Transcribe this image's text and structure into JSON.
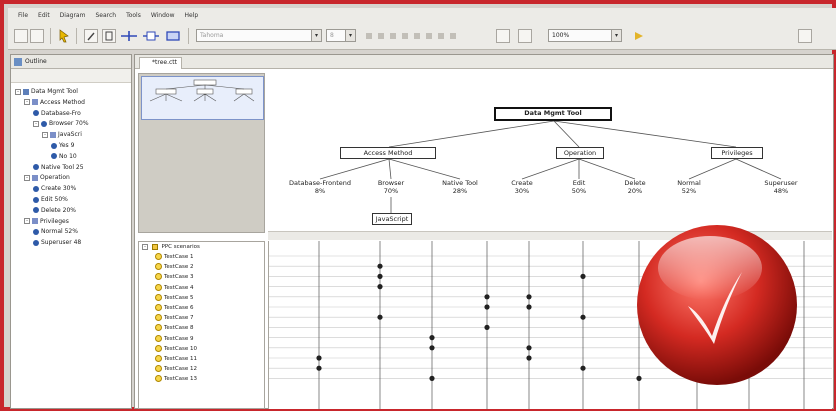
{
  "menu": [
    "File",
    "Edit",
    "Diagram",
    "Search",
    "Tools",
    "Window",
    "Help"
  ],
  "toolbar": {
    "font_combo": "Tahoma",
    "size_combo": "8",
    "zoom_combo": "100%"
  },
  "outline": {
    "tab_label": "Outline",
    "items": [
      {
        "label": "Data Mgmt Tool",
        "level": 0,
        "kind": "root",
        "twisty": "-"
      },
      {
        "label": "Access Method",
        "level": 1,
        "kind": "cat",
        "twisty": "-"
      },
      {
        "label": "Database-Fro",
        "level": 2,
        "kind": "leaf",
        "twisty": ""
      },
      {
        "label": "Browser 70%",
        "level": 2,
        "kind": "leaf",
        "twisty": "-"
      },
      {
        "label": "JavaScri",
        "level": 3,
        "kind": "cat",
        "twisty": "-"
      },
      {
        "label": "Yes 9",
        "level": 4,
        "kind": "leaf",
        "twisty": ""
      },
      {
        "label": "No 10",
        "level": 4,
        "kind": "leaf",
        "twisty": ""
      },
      {
        "label": "Native Tool 25",
        "level": 2,
        "kind": "leaf",
        "twisty": ""
      },
      {
        "label": "Operation",
        "level": 1,
        "kind": "cat",
        "twisty": "-"
      },
      {
        "label": "Create 30%",
        "level": 2,
        "kind": "leaf",
        "twisty": ""
      },
      {
        "label": "Edit 50%",
        "level": 2,
        "kind": "leaf",
        "twisty": ""
      },
      {
        "label": "Delete 20%",
        "level": 2,
        "kind": "leaf",
        "twisty": ""
      },
      {
        "label": "Privileges",
        "level": 1,
        "kind": "cat",
        "twisty": "-"
      },
      {
        "label": "Normal 52%",
        "level": 2,
        "kind": "leaf",
        "twisty": ""
      },
      {
        "label": "Superuser 48",
        "level": 2,
        "kind": "leaf",
        "twisty": ""
      }
    ]
  },
  "editor": {
    "tab_label": "*tree.ctt",
    "root_label": "Data Mgmt Tool",
    "categories": [
      "Access Method",
      "Operation",
      "Privileges"
    ],
    "leaves": [
      {
        "name": "Database-Frontend",
        "pct": "8%"
      },
      {
        "name": "Browser",
        "pct": "70%"
      },
      {
        "name": "Native Tool",
        "pct": "28%",
        "inline": true
      },
      {
        "name": "Create",
        "pct": "30%"
      },
      {
        "name": "Edit",
        "pct": "50%"
      },
      {
        "name": "Delete",
        "pct": "20%"
      },
      {
        "name": "Normal",
        "pct": "52%"
      },
      {
        "name": "Superuser",
        "pct": "48%"
      }
    ],
    "subnode": "JavaScript"
  },
  "testcases": {
    "group_label": "PPC scenarios",
    "items": [
      "TestCase 1",
      "TestCase 2",
      "TestCase 3",
      "TestCase 4",
      "TestCase 5",
      "TestCase 6",
      "TestCase 7",
      "TestCase 8",
      "TestCase 9",
      "TestCase 10",
      "TestCase 11",
      "TestCase 12",
      "TestCase 13"
    ]
  },
  "colors": {
    "frame": "#c8262c",
    "badge": "#d42a22"
  }
}
